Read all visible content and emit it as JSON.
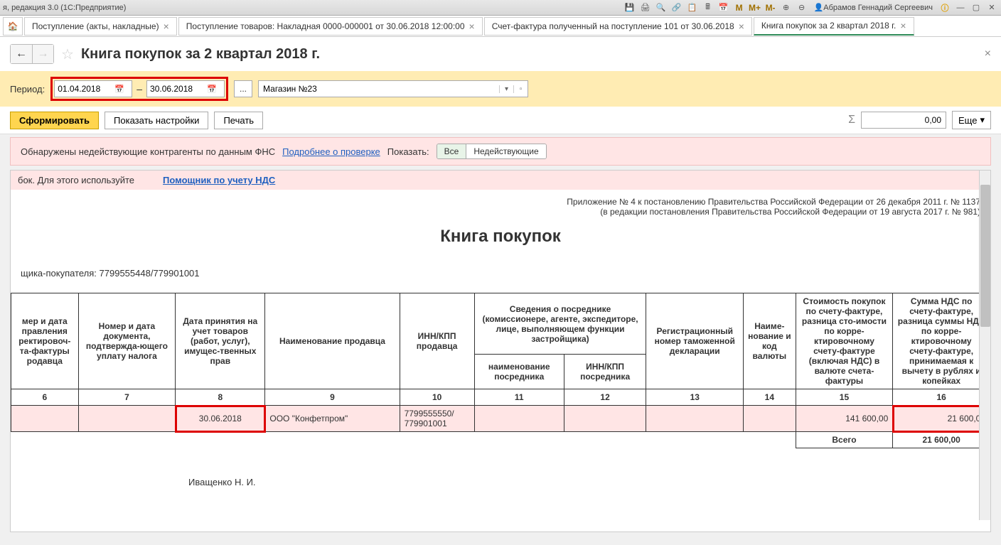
{
  "titlebar": {
    "text": "я, редакция 3.0  (1С:Предприятие)",
    "user": "Абрамов Геннадий Сергеевич",
    "m1": "M",
    "m2": "M+",
    "m3": "M-"
  },
  "tabs": [
    {
      "label": "Поступление (акты, накладные)"
    },
    {
      "label": "Поступление товаров: Накладная 0000-000001 от 30.06.2018 12:00:00"
    },
    {
      "label": "Счет-фактура полученный на поступление 101 от 30.06.2018"
    },
    {
      "label": "Книга покупок за 2 квартал 2018 г."
    }
  ],
  "page": {
    "title": "Книга покупок за 2 квартал 2018 г."
  },
  "period": {
    "label": "Период:",
    "from": "01.04.2018",
    "to": "30.06.2018",
    "store": "Магазин №23",
    "dots": "..."
  },
  "actions": {
    "form": "Сформировать",
    "settings": "Показать настройки",
    "print": "Печать",
    "sum": "0,00",
    "more": "Еще"
  },
  "warning": {
    "text": "Обнаружены недействующие контрагенты по данным ФНС",
    "link": "Подробнее о проверке",
    "show": "Показать:",
    "all": "Все",
    "inactive": "Недействующие"
  },
  "helper": {
    "text": "бок. Для этого используйте",
    "link": "Помощник по учету НДС"
  },
  "doc": {
    "meta1": "Приложение № 4 к постановлению Правительства Российской Федерации от 26 декабря 2011 г. № 1137",
    "meta2": "(в редакции постановления Правительства Российской Федерации от 19 августа 2017 г. № 981)",
    "title": "Книга покупок",
    "info": "щика-покупателя:  7799555448/779901001"
  },
  "headers": {
    "h6": "мер и дата правления ректировоч-  та-фактуры родавца",
    "h7": "Номер и дата документа, подтвержда-ющего уплату налога",
    "h8": "Дата принятия на учет товаров (работ, услуг), имущес-твенных прав",
    "h9": "Наименование продавца",
    "h10": "ИНН/КПП продавца",
    "h11top": "Сведения о посреднике (комиссионере, агенте, экспедиторе, лице, выполняющем функции застройщика)",
    "h11": "наименование посредника",
    "h12": "ИНН/КПП посредника",
    "h13": "Регистрационный номер таможенной декларации",
    "h14": "Наиме-нование и код валюты",
    "h15": "Стоимость покупок по счету-фактуре, разница сто-имости по корре-ктировочному счету-фактуре (включая НДС) в валюте счета-фактуры",
    "h16": "Сумма НДС по счету-фактуре, разница суммы НДС по корре-ктировочному счету-фактуре, принимаемая к вычету в рублях и копейках"
  },
  "colnums": {
    "c6": "6",
    "c7": "7",
    "c8": "8",
    "c9": "9",
    "c10": "10",
    "c11": "11",
    "c12": "12",
    "c13": "13",
    "c14": "14",
    "c15": "15",
    "c16": "16"
  },
  "row": {
    "date": "30.06.2018",
    "seller": "ООО \"Конфетпром\"",
    "inn": "7799555550/ 779901001",
    "cost": "141 600,00",
    "vat": "21 600,00"
  },
  "total": {
    "label": "Всего",
    "value": "21 600,00"
  },
  "footer": {
    "name": "Иващенко Н. И."
  }
}
